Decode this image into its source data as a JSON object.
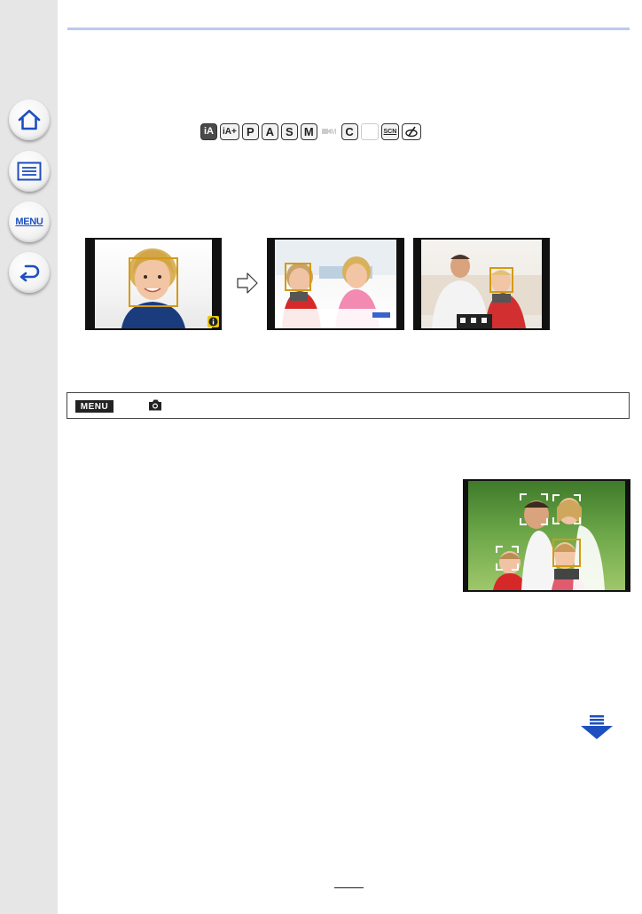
{
  "sidebar": {
    "items": [
      {
        "name": "home",
        "icon": "home-icon"
      },
      {
        "name": "contents",
        "icon": "list-icon"
      },
      {
        "name": "menu",
        "icon": "menu-icon",
        "label": "MENU"
      },
      {
        "name": "back",
        "icon": "back-arrow-icon"
      }
    ],
    "accent": "#1d4fc0"
  },
  "modes": {
    "items": [
      "iA",
      "iA+",
      "P",
      "A",
      "S",
      "M",
      "M",
      "C",
      "",
      "SCN",
      ""
    ],
    "accent": "#333333"
  },
  "menu_path": {
    "tag": "MENU",
    "icon": "camera-icon"
  },
  "colors": {
    "header_rule": "#bcc8ee",
    "face_frame": "#d49a14",
    "next_page_arrow": "#1d4fc0"
  }
}
